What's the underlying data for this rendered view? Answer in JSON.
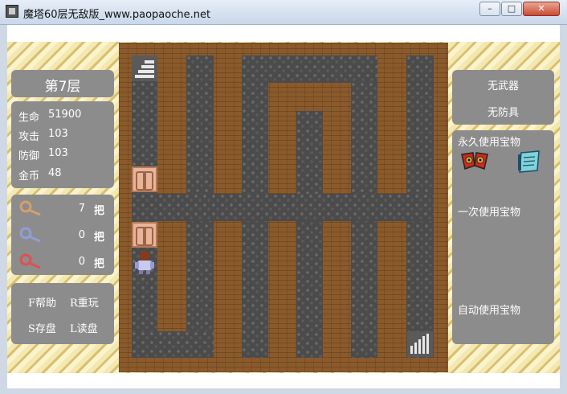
{
  "window": {
    "title": "魔塔60层无敌版_www.paopaoche.net",
    "buttons": {
      "minimize": "–",
      "maximize": "□",
      "close": "✕"
    }
  },
  "floor": {
    "label": "第7层"
  },
  "stats": [
    {
      "label": "生命",
      "value": "51900"
    },
    {
      "label": "攻击",
      "value": "103"
    },
    {
      "label": "防御",
      "value": "103"
    },
    {
      "label": "金币",
      "value": "48"
    }
  ],
  "keys": [
    {
      "color": "#d4a06a",
      "count": "7",
      "unit": "把"
    },
    {
      "color": "#8f9fd6",
      "count": "0",
      "unit": "把"
    },
    {
      "color": "#e05050",
      "count": "0",
      "unit": "把"
    }
  ],
  "help": {
    "help": "F帮助",
    "restart": "R重玩",
    "save": "S存盘",
    "load": "L读盘"
  },
  "equipment": {
    "weapon": "无武器",
    "armor": "无防具"
  },
  "treasures": {
    "permanent": "永久使用宝物",
    "once": "一次使用宝物",
    "auto": "自动使用宝物"
  },
  "icons": {
    "stairs_up": "stairs-up-icon",
    "stairs_down": "stairs-down-icon",
    "hero": "hero-icon",
    "door": "yellow-door-icon",
    "monster_manual": "monster-manual-icon",
    "notepad": "notepad-icon"
  }
}
